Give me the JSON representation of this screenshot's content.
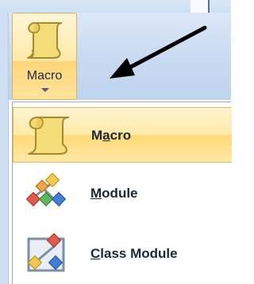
{
  "ribbon": {
    "macro_button": {
      "label": "Macro",
      "icon": "macro-scroll-icon"
    }
  },
  "annotation": {
    "icon": "black-arrow-pointer"
  },
  "menu": {
    "items": [
      {
        "label": "Macro",
        "underline_char": "a",
        "icon": "macro-scroll-icon",
        "highlighted": true
      },
      {
        "label": "Module",
        "underline_char": "M",
        "icon": "module-icon",
        "highlighted": false
      },
      {
        "label": "Class Module",
        "underline_char": "C",
        "icon": "class-module-icon",
        "highlighted": false
      }
    ]
  },
  "colors": {
    "highlight": "#ffe39b",
    "ribbon_bg": "#c6d9f1",
    "border": "#d7b266"
  }
}
